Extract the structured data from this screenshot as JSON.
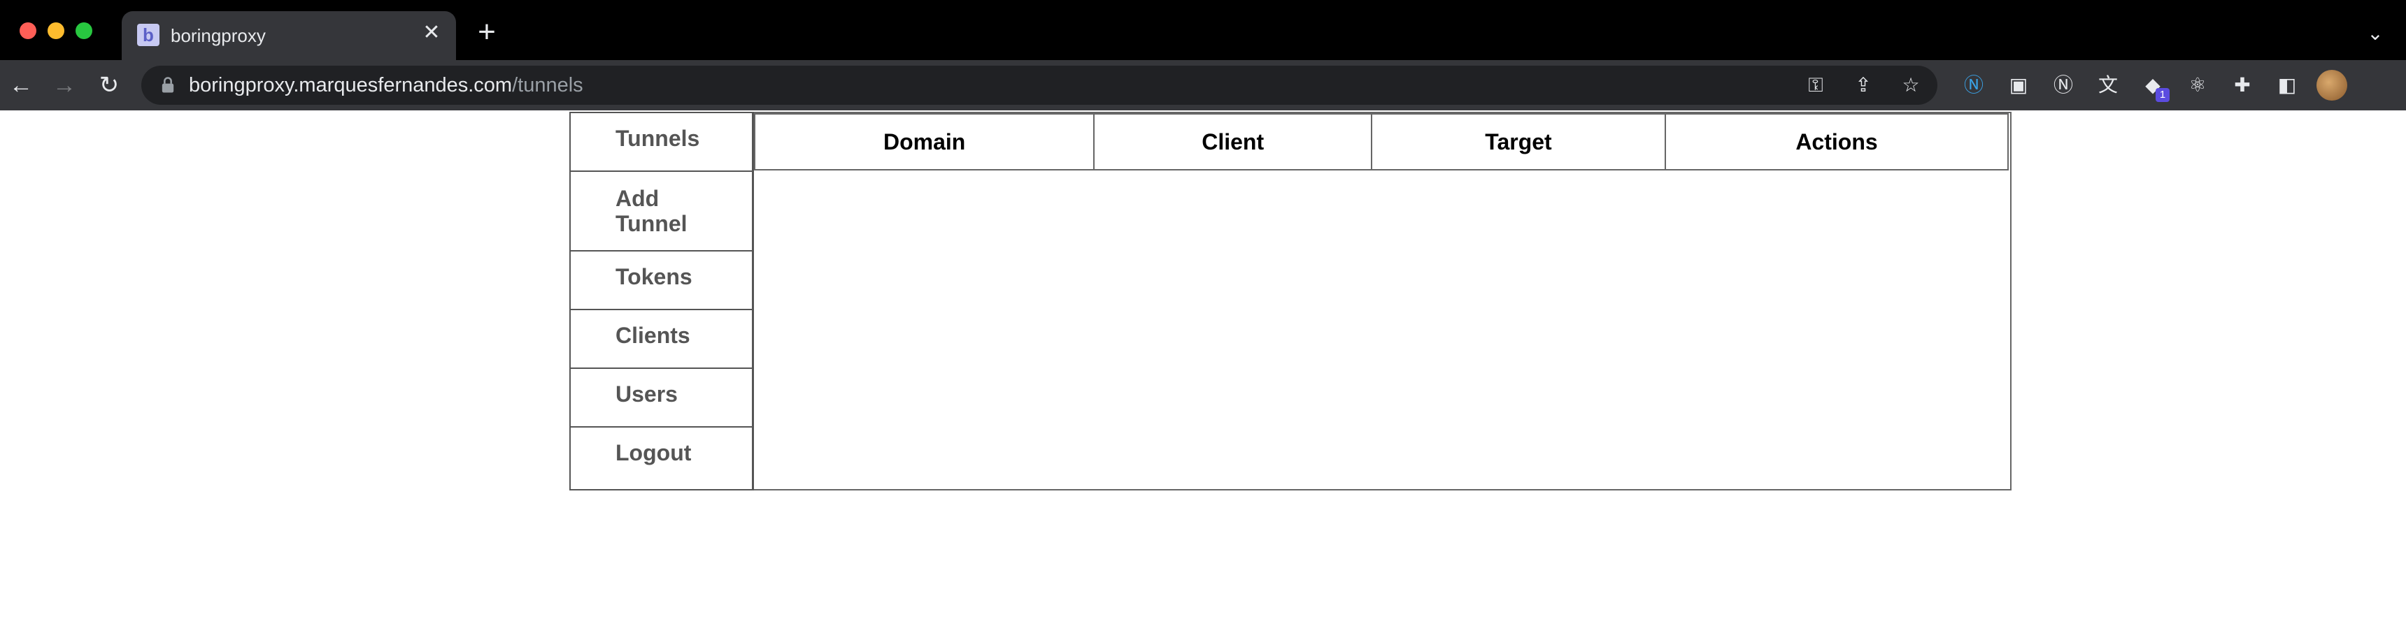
{
  "browser": {
    "tab_title": "boringproxy",
    "favicon_letter": "b",
    "url_host": "boringproxy.marquesfernandes.com",
    "url_path": "/tunnels"
  },
  "sidebar": {
    "items": [
      {
        "label": "Tunnels"
      },
      {
        "label": "Add Tunnel"
      },
      {
        "label": "Tokens"
      },
      {
        "label": "Clients"
      },
      {
        "label": "Users"
      },
      {
        "label": "Logout"
      }
    ]
  },
  "table": {
    "headers": [
      "Domain",
      "Client",
      "Target",
      "Actions"
    ],
    "rows": []
  },
  "icons": {
    "back": "arrow-left-icon",
    "forward": "arrow-right-icon",
    "reload": "reload-icon",
    "lock": "lock-icon",
    "key": "key-icon",
    "share": "share-icon",
    "star": "star-icon",
    "extensions": "puzzle-icon"
  }
}
